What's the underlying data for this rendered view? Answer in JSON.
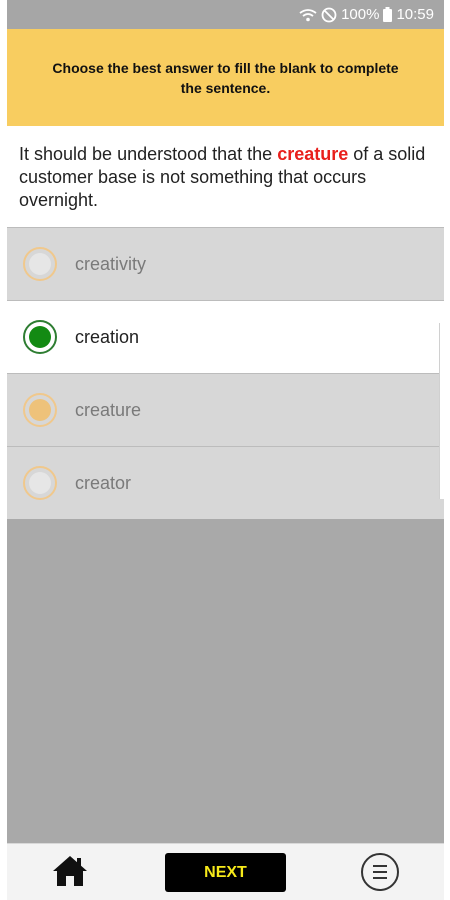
{
  "status_bar": {
    "battery_percent": "100%",
    "time": "10:59",
    "icons": [
      "wifi-icon",
      "no-disturb-icon",
      "battery-icon"
    ]
  },
  "instruction": {
    "text": "Choose the best answer to fill the blank to complete the sentence."
  },
  "question": {
    "before": "It should be understood that the",
    "highlight": "creature",
    "after": "of a solid customer base is not something that occurs overnight."
  },
  "options": [
    {
      "label": "creativity",
      "state": "normal"
    },
    {
      "label": "creation",
      "state": "selected"
    },
    {
      "label": "creature",
      "state": "marked"
    },
    {
      "label": "creator",
      "state": "normal"
    }
  ],
  "bottom_bar": {
    "home_icon": "home-icon",
    "next_label": "NEXT",
    "menu_icon": "menu-icon"
  },
  "colors": {
    "instruction_bg": "#f8cd60",
    "highlight": "#e8201c",
    "selected_radio": "#138a13",
    "next_text": "#f7ea1a"
  }
}
